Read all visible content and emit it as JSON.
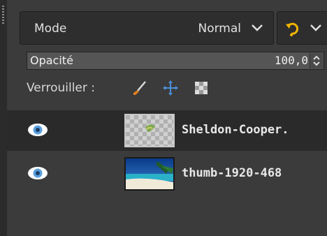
{
  "mode": {
    "label": "Mode",
    "value": "Normal"
  },
  "opacity": {
    "label": "Opacité",
    "value": "100,0"
  },
  "lock": {
    "label": "Verrouiller :"
  },
  "icons": {
    "chevron": "chevron-down-icon",
    "swap": "composite-swap-icon",
    "paint_lock": "paintbrush-icon",
    "move_lock": "move-cross-icon",
    "alpha_lock": "alpha-checker-icon",
    "visibility": "eye-icon"
  },
  "colors": {
    "panel_bg": "#3b3b3b",
    "selected_row": "#2a2a2a",
    "swap_icon": "#f0b400",
    "move_icon": "#4a90d9",
    "eye": "#5aa0e0"
  },
  "layers": [
    {
      "name": "Sheldon-Cooper.",
      "selected": true
    },
    {
      "name": "thumb-1920-468",
      "selected": false
    }
  ]
}
